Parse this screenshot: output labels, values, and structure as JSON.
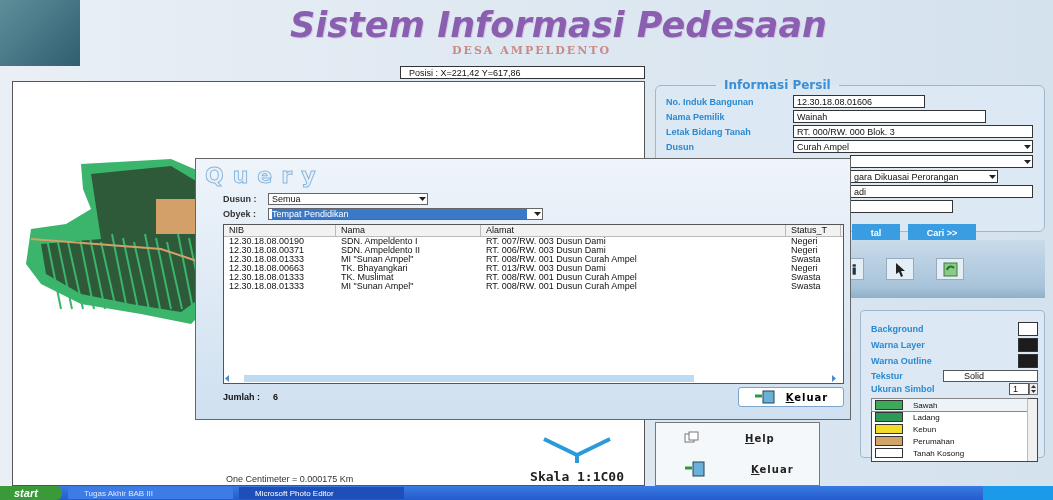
{
  "app": {
    "title": "Sistem Informasi Pedesaan",
    "subtitle": "DESA AMPELDENTO",
    "position": "Posisi : X=221,42  Y=617,86"
  },
  "map": {
    "scale": "Skala 1:1C00",
    "scale_note": "One Centimeter = 0.000175 Km"
  },
  "persil": {
    "title": "Informasi Persil",
    "fields": [
      {
        "kind": "text",
        "label": "No. Induk Bangunan",
        "value": "12.30.18.08.01606"
      },
      {
        "kind": "text",
        "label": "Nama Pemilik",
        "value": "Wainah"
      },
      {
        "kind": "text",
        "label": "Letak Bidang Tanah",
        "value": "RT. 000/RW. 000  Blok. 3"
      },
      {
        "kind": "dropdown",
        "label": "Dusun",
        "value": "Curah Ampel"
      },
      {
        "kind": "dropdown"
      },
      {
        "kind": "dropdown",
        "value": "gara Dikuasai Perorangan"
      },
      {
        "kind": "text",
        "value": "adi"
      },
      {
        "kind": "text"
      }
    ],
    "buttons": [
      "tal",
      "Cari >>"
    ]
  },
  "legend": {
    "settings": [
      {
        "kind": "color",
        "label": "Background",
        "color": "#ffffff"
      },
      {
        "kind": "color",
        "label": "Warna Layer",
        "color": "#1c1c1c"
      },
      {
        "kind": "color",
        "label": "Warna Outline",
        "color": "#1c1c1c"
      },
      {
        "kind": "dropdown",
        "label": "Tekstur",
        "value": "Solid"
      },
      {
        "kind": "spinner",
        "label": "Ukuran Simbol",
        "value": "1"
      }
    ],
    "items": [
      {
        "label": "Sawah",
        "color": "#3caa5a",
        "selected": true
      },
      {
        "label": "Ladang",
        "color": "#2e9a58",
        "selected": false
      },
      {
        "label": "Kebun",
        "color": "#f2dc2a",
        "selected": false
      },
      {
        "label": "Perumahan",
        "color": "#d2a46a",
        "selected": false
      },
      {
        "label": "Tanah Kosong",
        "color": "#ffffff",
        "selected": false
      }
    ]
  },
  "menu": [
    {
      "kind": "help",
      "label": "Help"
    },
    {
      "kind": "exit",
      "label": "Keluar"
    }
  ],
  "query": {
    "title": "Query",
    "filters": [
      {
        "label": "Dusun :",
        "value": "Semua",
        "focused": false
      },
      {
        "label": "Obyek :",
        "value": "Tempat Pendidikan",
        "focused": true
      }
    ],
    "table": {
      "columns": [
        "NIB",
        "Nama",
        "Alamat",
        "Status_T"
      ],
      "rows": [
        [
          "12.30.18.08.00190",
          "SDN. Ampeldento I",
          "RT. 007/RW. 003 Dusun Dami",
          "Negeri"
        ],
        [
          "12.30.18.08.00371",
          "SDN. Ampeldento II",
          "RT. 006/RW. 003 Dusun Dami",
          "Negeri"
        ],
        [
          "12.30.18.08.01333",
          "MI \"Sunan Ampel\"",
          "RT. 008/RW. 001 Dusun Curah Ampel",
          "Swasta"
        ],
        [
          "12.30.18.08.00663",
          "TK. Bhayangkari",
          "RT. 013/RW. 003 Dusun Dami",
          "Negeri"
        ],
        [
          "12.30.18.08.01333",
          "TK. Muslimat",
          "RT. 008/RW. 001 Dusun Curah Ampel",
          "Swasta"
        ],
        [
          "12.30.18.08.01333",
          "MI \"Sunan Ampel\"",
          "RT. 008/RW. 001 Dusun Curah Ampel",
          "Swasta"
        ]
      ]
    },
    "count_label": "Jumlah :",
    "count": "6",
    "button": "Keluar"
  },
  "taskbar": {
    "start": "start",
    "tasks": [
      {
        "label": "Tugas Akhir BAB III",
        "selected": false
      },
      {
        "label": "Microsoft Photo Editor",
        "selected": true
      }
    ]
  }
}
